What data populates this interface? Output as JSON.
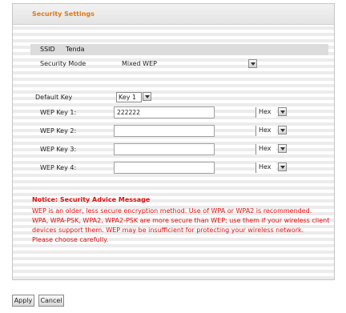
{
  "header": {
    "title": "Security Settings"
  },
  "ssid": {
    "label": "SSID",
    "value": "Tenda"
  },
  "security_mode": {
    "label": "Security Mode",
    "value": "Mixed WEP"
  },
  "default_key": {
    "label": "Default Key",
    "value": "Key 1"
  },
  "keys": [
    {
      "label": "WEP Key 1:",
      "value": "222222",
      "format": "Hex"
    },
    {
      "label": "WEP Key 2:",
      "value": "",
      "format": "Hex"
    },
    {
      "label": "WEP Key 3:",
      "value": "",
      "format": "Hex"
    },
    {
      "label": "WEP Key 4:",
      "value": "",
      "format": "Hex"
    }
  ],
  "warning": {
    "title": "Notice: Security Advice Message",
    "lines": [
      "WEP is an older, less secure encryption method. Use of WPA or WPA2 is recommended.",
      "WPA, WPA-PSK, WPA2, WPA2-PSK are more secure than WEP; use them if your wireless client",
      "devices support them. WEP may be insufficient for protecting your wireless network.",
      "Please choose carefully."
    ]
  },
  "buttons": {
    "apply": "Apply",
    "cancel": "Cancel"
  }
}
